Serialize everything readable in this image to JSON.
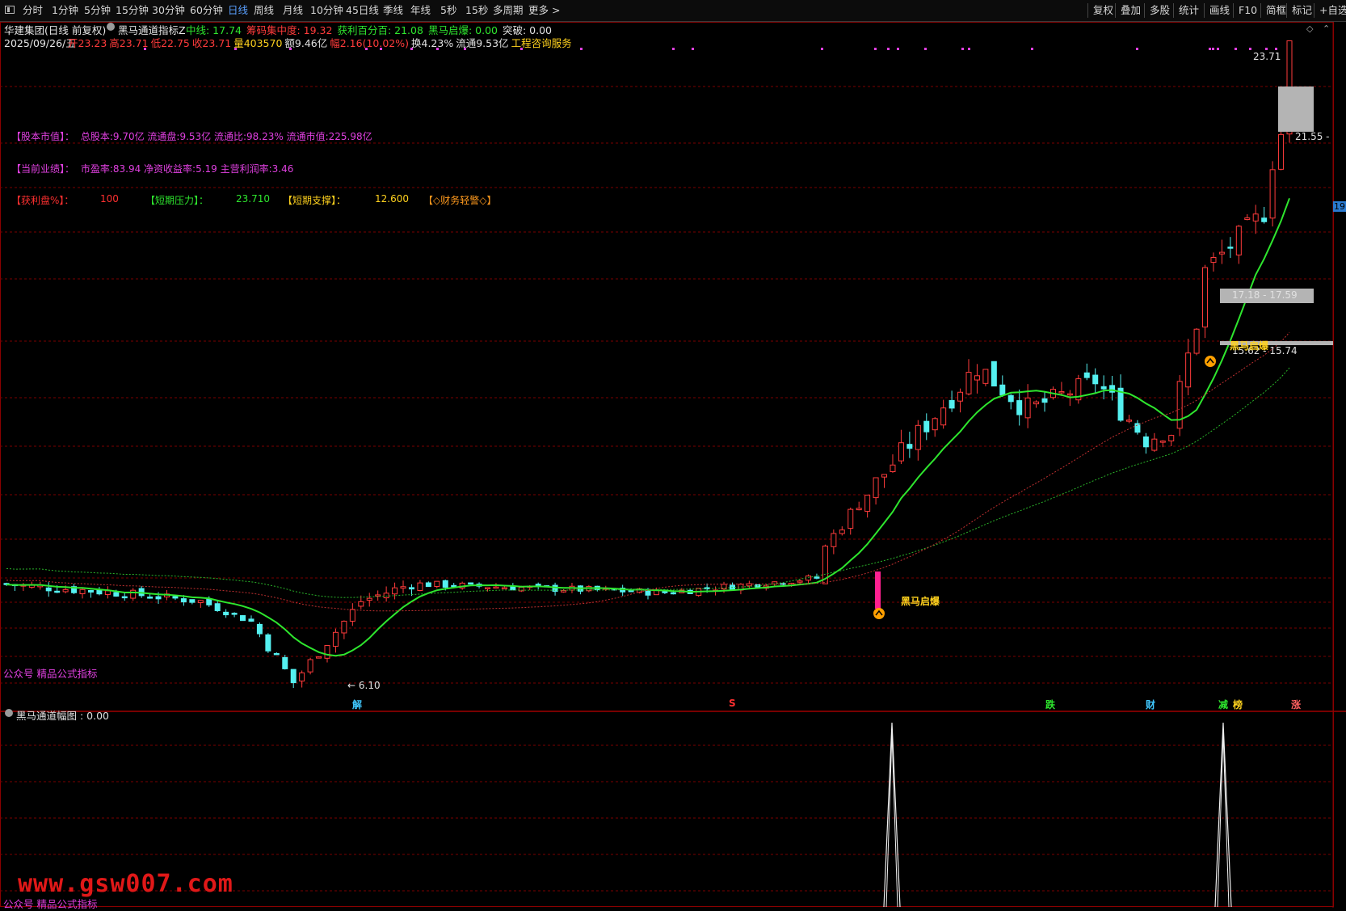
{
  "toolbar": {
    "periods": [
      "分时",
      "1分钟",
      "5分钟",
      "15分钟",
      "30分钟",
      "60分钟",
      "日线",
      "周线",
      "月线",
      "10分钟",
      "45日线",
      "季线",
      "年线",
      "5秒",
      "15秒",
      "多周期",
      "更多 >"
    ],
    "active_period": "日线",
    "right_buttons": [
      "复权",
      "叠加",
      "多股",
      "统计",
      "画线",
      "F10",
      "简框",
      "标记",
      "+自选"
    ]
  },
  "header": {
    "stock_name": "华建集团(日线 前复权)",
    "indicator_name": "黑马通道指标Z",
    "line1": [
      {
        "label": "中线: 17.74",
        "color": "#2ee62e"
      },
      {
        "label": "筹码集中度: 19.32",
        "color": "#ff3b3b"
      },
      {
        "label": "获利百分百: 21.08",
        "color": "#2ee62e"
      },
      {
        "label": "黑马启爆: 0.00",
        "color": "#2ee62e"
      },
      {
        "label": "突破: 0.00",
        "color": "#e0e0e0"
      }
    ],
    "date": "2025/09/26/五",
    "line2": [
      {
        "label": "开23.23",
        "color": "#ff3b3b"
      },
      {
        "label": "高23.71",
        "color": "#ff3b3b"
      },
      {
        "label": "低22.75",
        "color": "#ff3b3b"
      },
      {
        "label": "收23.71",
        "color": "#ff3b3b"
      },
      {
        "label": "量403570",
        "color": "#ffd21e"
      },
      {
        "label": "额9.46亿",
        "color": "#e0e0e0"
      },
      {
        "label": "幅2.16(10.02%)",
        "color": "#ff3b3b"
      },
      {
        "label": "换4.23%",
        "color": "#e0e0e0"
      },
      {
        "label": "流通9.53亿",
        "color": "#e0e0e0"
      },
      {
        "label": "工程咨询服务",
        "color": "#ffd21e"
      }
    ]
  },
  "info_panel": {
    "row1": {
      "label": "【股本市值】：",
      "text": "总股本:9.70亿 流通盘:9.53亿 流通比:98.23% 流通市值:225.98亿"
    },
    "row2": {
      "label": "【当前业绩】：",
      "text": "市盈率:83.94 净资收益率:5.19 主营利润率:3.46"
    },
    "row3": [
      {
        "label": "【获利盘%】：",
        "value": "100",
        "color": "#ff3030"
      },
      {
        "label": "【短期压力】：",
        "value": "23.710",
        "color": "#2ee62e"
      },
      {
        "label": "【短期支撑】：",
        "value": "12.600",
        "color": "#ffd21e"
      },
      {
        "label": "【◇财务轻警◇】",
        "value": "",
        "color": "#ff9a1e"
      }
    ]
  },
  "annotations": {
    "high_label": "23.71",
    "low_label": "6.10",
    "right_price_top": "21.55",
    "right_price_axis": "19.",
    "zone_label_1": "17.18 - 17.59",
    "zone_label_2": "15.62 - 15.74",
    "signal_label": "黑马启爆",
    "watermark_main": "公众号 精品公式指标",
    "bottom_markers": [
      {
        "text": "解",
        "color": "#40c8ff"
      },
      {
        "text": "S",
        "color": "#ff3030"
      },
      {
        "text": "跌",
        "color": "#2ee62e"
      },
      {
        "text": "财",
        "color": "#40c8ff"
      },
      {
        "text": "减",
        "color": "#2ee62e"
      },
      {
        "text": "榜",
        "color": "#ffd21e"
      },
      {
        "text": "涨",
        "color": "#ff6060"
      }
    ]
  },
  "sub_panel": {
    "title": "黑马通道幅图 : 0.00",
    "watermark": "公众号 精品公式指标"
  },
  "site_watermark": "www.gsw007.com",
  "colors": {
    "up": "#ff3b3b",
    "down": "#54f0f0",
    "ma": "#2ee62e",
    "grid": "#7a0000",
    "magenta": "#e040e0"
  }
}
